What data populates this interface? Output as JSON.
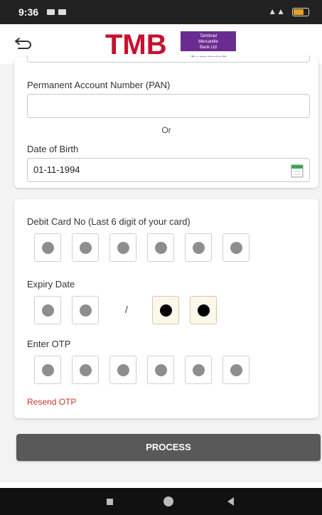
{
  "status_bar": {
    "time": "9:36"
  },
  "header": {
    "back_icon": "back-arrow-icon",
    "logo_text": "TMB",
    "logo_lines": [
      "Tamilnad",
      "Mercantile",
      "Bank Ltd"
    ],
    "logo_tagline": "Be a step ahead in life"
  },
  "identity": {
    "pan_label": "Permanent Account Number (PAN)",
    "pan_value": "",
    "or_text": "Or",
    "dob_label": "Date of Birth",
    "dob_value": "01-11-1994",
    "calendar_icon": "calendar-icon"
  },
  "debit_card": {
    "label": "Debit Card No (Last 6 digit of your card)",
    "digits_filled": [
      false,
      false,
      false,
      false,
      false,
      false
    ]
  },
  "expiry": {
    "label": "Expiry Date",
    "separator": "/",
    "month_filled": [
      false,
      false
    ],
    "year_filled": [
      true,
      true
    ]
  },
  "otp": {
    "label": "Enter OTP",
    "digits_filled": [
      false,
      false,
      false,
      false,
      false,
      false
    ],
    "resend_label": "Resend OTP"
  },
  "actions": {
    "process_label": "PROCESS"
  },
  "colors": {
    "brand_red": "#c8102e",
    "brand_purple": "#6b2c91",
    "button_bg": "#595959",
    "link_red": "#c0392b"
  }
}
